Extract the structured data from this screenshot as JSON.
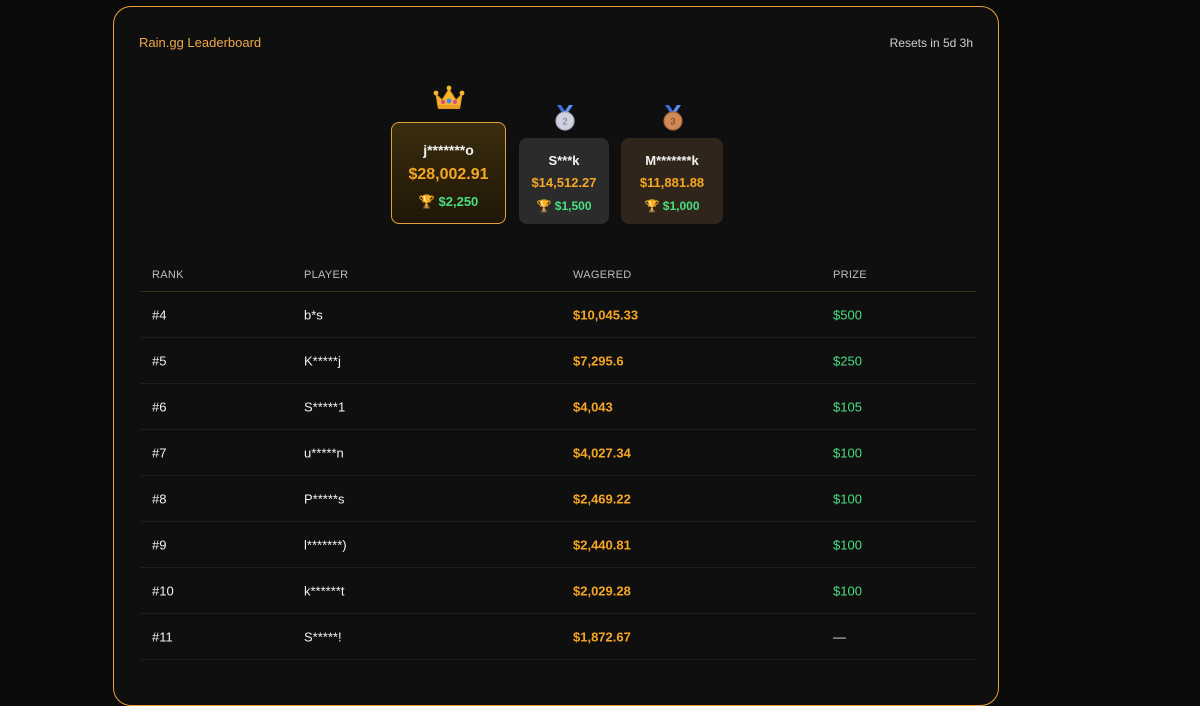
{
  "header": {
    "title": "Rain.gg Leaderboard",
    "reset": "Resets in 5d 3h"
  },
  "podium": [
    {
      "rank": 1,
      "name": "j*******o",
      "wagered": "$28,002.91",
      "prize": "$2,250",
      "icon": "crown-icon"
    },
    {
      "rank": 2,
      "name": "S***k",
      "wagered": "$14,512.27",
      "prize": "$1,500",
      "icon": "silver-medal-icon"
    },
    {
      "rank": 3,
      "name": "M*******k",
      "wagered": "$11,881.88",
      "prize": "$1,000",
      "icon": "bronze-medal-icon"
    }
  ],
  "table": {
    "headers": {
      "rank": "RANK",
      "player": "PLAYER",
      "wagered": "WAGERED",
      "prize": "PRIZE"
    },
    "rows": [
      {
        "rank": "#4",
        "player": "b*s",
        "wagered": "$10,045.33",
        "prize": "$500"
      },
      {
        "rank": "#5",
        "player": "K*****j",
        "wagered": "$7,295.6",
        "prize": "$250"
      },
      {
        "rank": "#6",
        "player": "S*****1",
        "wagered": "$4,043",
        "prize": "$105"
      },
      {
        "rank": "#7",
        "player": "u*****n",
        "wagered": "$4,027.34",
        "prize": "$100"
      },
      {
        "rank": "#8",
        "player": "P*****s",
        "wagered": "$2,469.22",
        "prize": "$100"
      },
      {
        "rank": "#9",
        "player": "l*******)",
        "wagered": "$2,440.81",
        "prize": "$100"
      },
      {
        "rank": "#10",
        "player": "k******t",
        "wagered": "$2,029.28",
        "prize": "$100"
      },
      {
        "rank": "#11",
        "player": "S*****!",
        "wagered": "$1,872.67",
        "prize": "—"
      }
    ]
  },
  "colors": {
    "accent": "#f5a623",
    "border": "#e8a33d",
    "prize": "#4ade80",
    "background": "#0a0a0a"
  },
  "prize_icon": "trophy-icon"
}
